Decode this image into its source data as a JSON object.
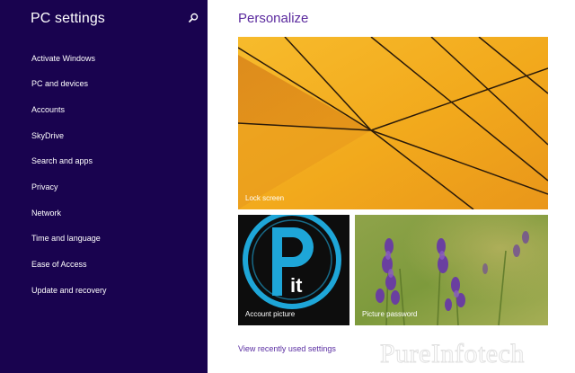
{
  "sidebar": {
    "title": "PC settings",
    "search_icon": "search-icon",
    "items": [
      {
        "label": "Activate Windows"
      },
      {
        "label": "PC and devices"
      },
      {
        "label": "Accounts"
      },
      {
        "label": "SkyDrive"
      },
      {
        "label": "Search and apps"
      },
      {
        "label": "Privacy"
      },
      {
        "label": "Network"
      },
      {
        "label": "Time and language"
      },
      {
        "label": "Ease of Access"
      },
      {
        "label": "Update and recovery"
      }
    ]
  },
  "main": {
    "title": "Personalize",
    "tiles": {
      "lock_screen": {
        "label": "Lock screen"
      },
      "account_picture": {
        "label": "Account picture",
        "logo_text": "it"
      },
      "picture_password": {
        "label": "Picture password"
      }
    },
    "recent_link": "View recently used settings"
  },
  "watermark": "PureInfotech",
  "colors": {
    "sidebar_bg": "#19034f",
    "accent": "#5b2a9e",
    "lock_screen_orange": "#f0a81e",
    "account_tile_bg": "#0d0d0d",
    "logo_blue": "#1ea6d8"
  }
}
